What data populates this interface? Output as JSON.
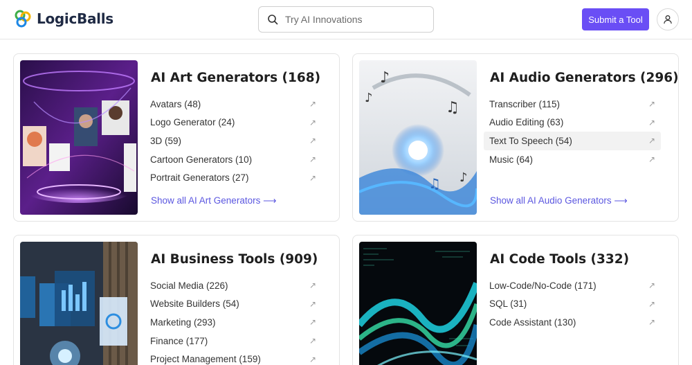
{
  "header": {
    "logo_text": "LogicBalls",
    "search_placeholder": "Try AI Innovations",
    "submit_label": "Submit a Tool"
  },
  "colors": {
    "accent": "#6a4ef5",
    "link": "#5b57e0"
  },
  "cards": [
    {
      "title": "AI Art Generators (168)",
      "items": [
        "Avatars (48)",
        "Logo Generator (24)",
        "3D (59)",
        "Cartoon Generators (10)",
        "Portrait Generators (27)"
      ],
      "show_all": "Show all AI Art Generators ⟶"
    },
    {
      "title": "AI Audio Generators (296)",
      "items": [
        "Transcriber (115)",
        "Audio Editing (63)",
        "Text To Speech (54)",
        "Music (64)"
      ],
      "show_all": "Show all AI Audio Generators ⟶"
    },
    {
      "title": "AI Business Tools (909)",
      "items": [
        "Social Media (226)",
        "Website Builders (54)",
        "Marketing (293)",
        "Finance (177)",
        "Project Management (159)"
      ]
    },
    {
      "title": "AI Code Tools (332)",
      "items": [
        "Low-Code/No-Code (171)",
        "SQL (31)",
        "Code Assistant (130)"
      ]
    }
  ]
}
